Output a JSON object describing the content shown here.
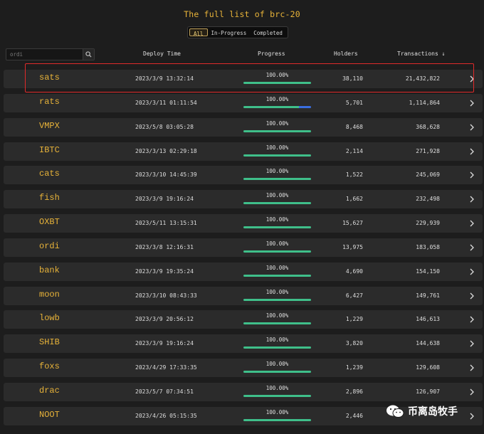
{
  "page": {
    "title": "The full list of brc-20"
  },
  "tabs": [
    {
      "label": "All",
      "active": true
    },
    {
      "label": "In-Progress",
      "active": false
    },
    {
      "label": "Completed",
      "active": false
    }
  ],
  "search": {
    "placeholder": "ordi",
    "icon": "search-icon"
  },
  "columns": {
    "deploy_time": "Deploy Time",
    "progress": "Progress",
    "holders": "Holders",
    "transactions": "Transactions ↓"
  },
  "colors": {
    "accent": "#e8b339",
    "progress": "#3fbf8a",
    "highlight": "#e02a2a"
  },
  "rows": [
    {
      "tick": "sats",
      "deploy_time": "2023/3/9 13:32:14",
      "progress": "100.00%",
      "progress_value": 1.0,
      "holders": "38,110",
      "transactions": "21,432,822"
    },
    {
      "tick": "rats",
      "deploy_time": "2023/3/11 01:11:54",
      "progress": "100.00%",
      "progress_value": 1.0,
      "holders": "5,701",
      "transactions": "1,114,864"
    },
    {
      "tick": "VMPX",
      "deploy_time": "2023/5/8 03:05:28",
      "progress": "100.00%",
      "progress_value": 1.0,
      "holders": "8,468",
      "transactions": "368,628"
    },
    {
      "tick": "IBTC",
      "deploy_time": "2023/3/13 02:29:18",
      "progress": "100.00%",
      "progress_value": 1.0,
      "holders": "2,114",
      "transactions": "271,928"
    },
    {
      "tick": "cats",
      "deploy_time": "2023/3/10 14:45:39",
      "progress": "100.00%",
      "progress_value": 1.0,
      "holders": "1,522",
      "transactions": "245,069"
    },
    {
      "tick": "fish",
      "deploy_time": "2023/3/9 19:16:24",
      "progress": "100.00%",
      "progress_value": 1.0,
      "holders": "1,662",
      "transactions": "232,498"
    },
    {
      "tick": "OXBT",
      "deploy_time": "2023/5/11 13:15:31",
      "progress": "100.00%",
      "progress_value": 1.0,
      "holders": "15,627",
      "transactions": "229,939"
    },
    {
      "tick": "ordi",
      "deploy_time": "2023/3/8 12:16:31",
      "progress": "100.00%",
      "progress_value": 1.0,
      "holders": "13,975",
      "transactions": "183,058"
    },
    {
      "tick": "bank",
      "deploy_time": "2023/3/9 19:35:24",
      "progress": "100.00%",
      "progress_value": 1.0,
      "holders": "4,690",
      "transactions": "154,150"
    },
    {
      "tick": "moon",
      "deploy_time": "2023/3/10 08:43:33",
      "progress": "100.00%",
      "progress_value": 1.0,
      "holders": "6,427",
      "transactions": "149,761"
    },
    {
      "tick": "lowb",
      "deploy_time": "2023/3/9 20:56:12",
      "progress": "100.00%",
      "progress_value": 1.0,
      "holders": "1,229",
      "transactions": "146,613"
    },
    {
      "tick": "SHIB",
      "deploy_time": "2023/3/9 19:16:24",
      "progress": "100.00%",
      "progress_value": 1.0,
      "holders": "3,820",
      "transactions": "144,638"
    },
    {
      "tick": "foxs",
      "deploy_time": "2023/4/29 17:33:35",
      "progress": "100.00%",
      "progress_value": 1.0,
      "holders": "1,239",
      "transactions": "129,608"
    },
    {
      "tick": "drac",
      "deploy_time": "2023/5/7 07:34:51",
      "progress": "100.00%",
      "progress_value": 1.0,
      "holders": "2,896",
      "transactions": "126,907"
    },
    {
      "tick": "NOOT",
      "deploy_time": "2023/4/26 05:15:35",
      "progress": "100.00%",
      "progress_value": 1.0,
      "holders": "2,446",
      "transactions": ""
    }
  ],
  "watermark": {
    "text": "币离岛牧手",
    "icon": "wechat-icon"
  }
}
